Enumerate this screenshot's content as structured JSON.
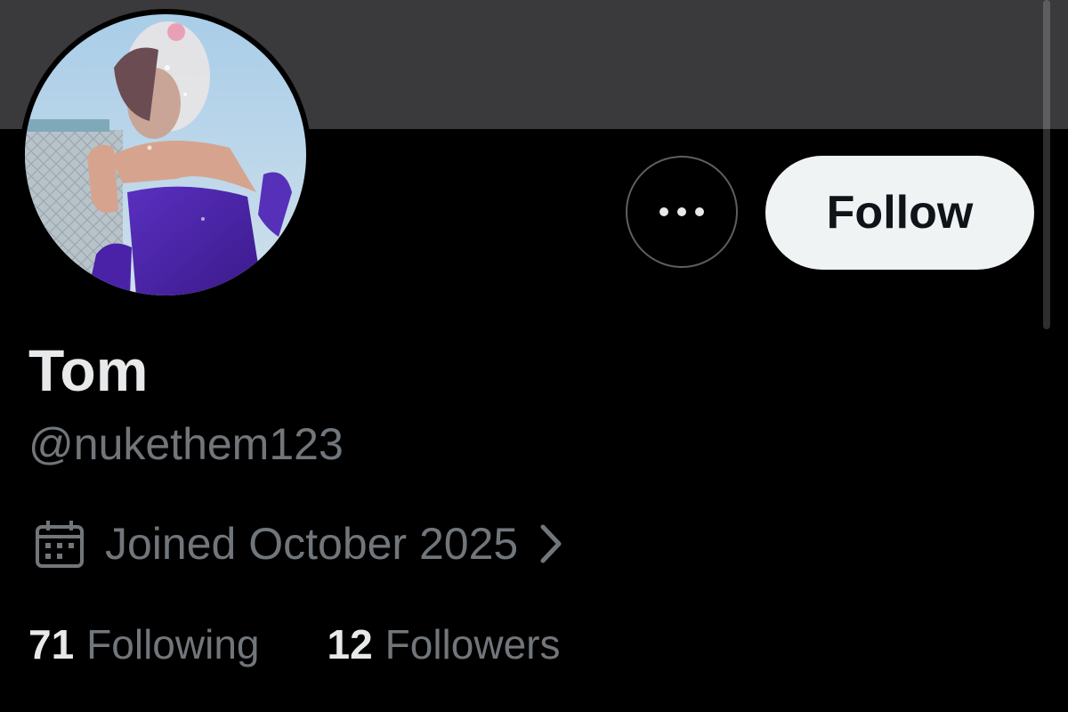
{
  "profile": {
    "display_name": "Tom",
    "handle": "@nukethem123",
    "avatar_icon": "profile-photo",
    "joined": "Joined October 2025",
    "joined_icon": "calendar-icon"
  },
  "actions": {
    "more_icon": "ellipsis-icon",
    "follow_label": "Follow"
  },
  "stats": {
    "following_count": "71",
    "following_label": "Following",
    "followers_count": "12",
    "followers_label": "Followers"
  },
  "colors": {
    "background": "#000000",
    "banner": "#3a3a3c",
    "primary_text": "#e7e9ea",
    "secondary_text": "#71767b",
    "follow_button_bg": "#eff3f4",
    "follow_button_text": "#0f1419",
    "outline": "#5b5f63"
  }
}
